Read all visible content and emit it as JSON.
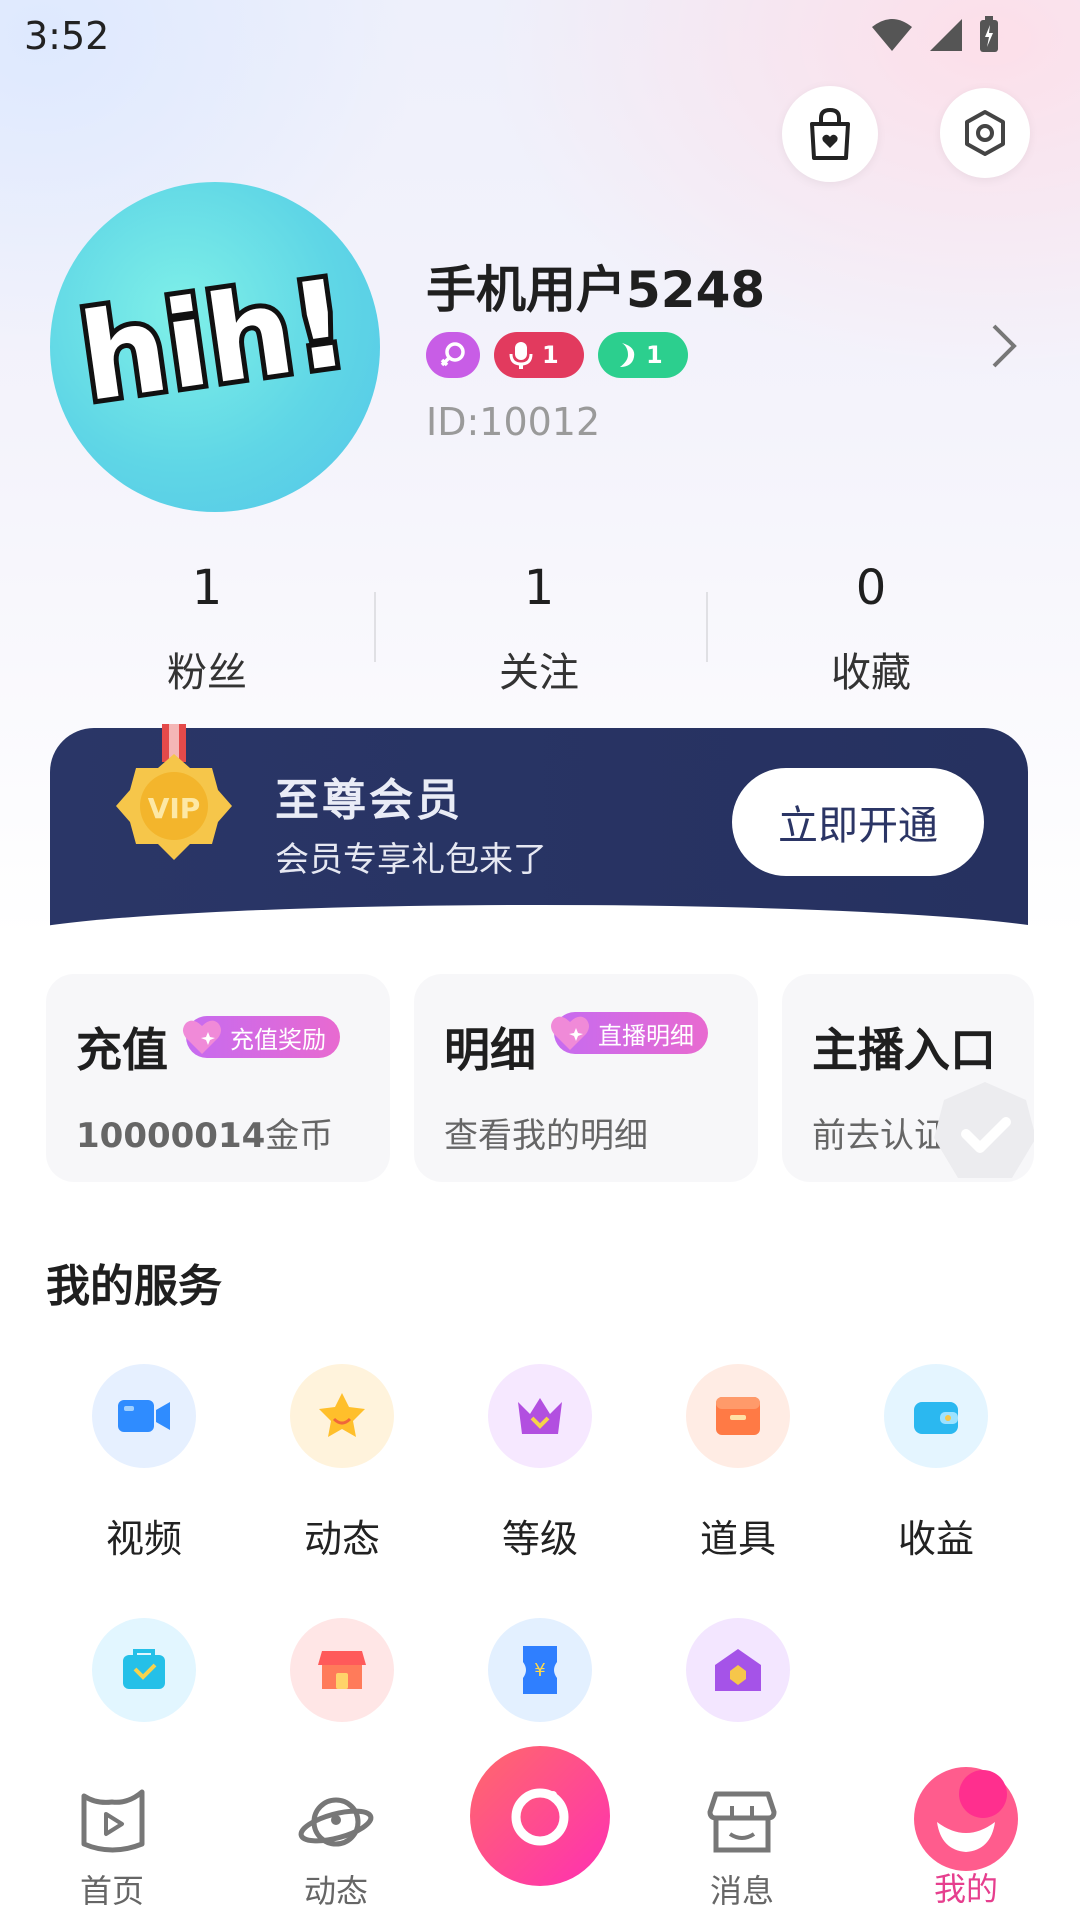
{
  "status": {
    "time": "3:52"
  },
  "profile": {
    "avatar_text": "hih!",
    "username": "手机用户5248",
    "badges": [
      {
        "icon": "female-icon",
        "value": "",
        "color": "#c85de6"
      },
      {
        "icon": "mic-icon",
        "value": "1",
        "color": "#e23a5e"
      },
      {
        "icon": "moon-icon",
        "value": "1",
        "color": "#2ccf8e"
      }
    ],
    "id": "ID:10012"
  },
  "stats": [
    {
      "value": "1",
      "label": "粉丝"
    },
    {
      "value": "1",
      "label": "关注"
    },
    {
      "value": "0",
      "label": "收藏"
    }
  ],
  "vip": {
    "medal_text": "VIP",
    "title": "至尊会员",
    "subtitle": "会员专享礼包来了",
    "button": "立即开通"
  },
  "cards": [
    {
      "title": "充值",
      "tag": "充值奖励",
      "sub_value": "10000014",
      "sub_unit": "金币"
    },
    {
      "title": "明细",
      "tag": "直播明细",
      "sub": "查看我的明细"
    },
    {
      "title": "主播入口",
      "sub": "前去认证"
    }
  ],
  "services": {
    "title": "我的服务",
    "items": [
      {
        "label": "视频",
        "icon": "video-icon",
        "bg": "#e6f0ff"
      },
      {
        "label": "动态",
        "icon": "star-icon",
        "bg": "#fff3dc"
      },
      {
        "label": "等级",
        "icon": "crown-icon",
        "bg": "#f6e8ff"
      },
      {
        "label": "道具",
        "icon": "box-icon",
        "bg": "#ffece4"
      },
      {
        "label": "收益",
        "icon": "wallet-icon",
        "bg": "#e4f5ff"
      },
      {
        "label": "",
        "icon": "bag-icon",
        "bg": "#e2f6ff"
      },
      {
        "label": "",
        "icon": "shop-icon",
        "bg": "#ffe6e6"
      },
      {
        "label": "",
        "icon": "ticket-icon",
        "bg": "#e3f0ff"
      },
      {
        "label": "",
        "icon": "house-icon",
        "bg": "#f3e6ff"
      }
    ]
  },
  "nav": {
    "items": [
      {
        "label": "首页",
        "icon": "home-icon"
      },
      {
        "label": "动态",
        "icon": "planet-icon"
      },
      {
        "label": "",
        "icon": "camera-icon"
      },
      {
        "label": "消息",
        "icon": "store-icon"
      },
      {
        "label": "我的",
        "icon": "me-icon"
      }
    ],
    "active_color": "#e63f8e"
  }
}
